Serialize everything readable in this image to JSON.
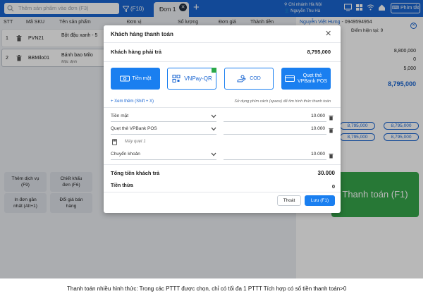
{
  "topbar": {
    "search_placeholder": "Thêm sản phẩm vào đơn (F3)",
    "filter_label": "(F10)",
    "tab_label": "Đơn 1",
    "branch": "Chi nhánh Hà Nội",
    "user": "Nguyễn Thu Hà",
    "keyboard_button": "Phím tắt"
  },
  "table": {
    "headers": [
      "STT",
      "Mã SKU",
      "Tên sản phẩm",
      "Đơn vị",
      "Số lượng",
      "Đơn giá",
      "Thành tiền"
    ],
    "rows": [
      {
        "stt": "1",
        "sku": "PVN21",
        "name": "Bột đậu xanh - 5",
        "note": ""
      },
      {
        "stt": "2",
        "sku": "BBMilo01",
        "name": "Bánh bao Milo",
        "note": "Mặc định"
      }
    ]
  },
  "customer": {
    "name": "Nguyễn Việt Hưng",
    "phone": "- 0949594954",
    "points_label": "Điểm hiện tại:",
    "points_value": "9"
  },
  "summary": {
    "v1": "8,800,000",
    "v2": "0",
    "v3": "5,000",
    "v4": "8,795,000",
    "pill1a": "8,795,000",
    "pill1b": "8,795,000",
    "pill2a": "8,795,000",
    "pill2b": "8,795,000"
  },
  "bottom_buttons": [
    {
      "line1": "Thêm dịch vụ",
      "line2": "(F9)"
    },
    {
      "line1": "Chiết khấu",
      "line2": "đơn (F6)"
    },
    {
      "line1": "In đơn gần",
      "line2": "nhất (Alt+1)"
    },
    {
      "line1": "Đổi giá bán",
      "line2": "hàng"
    }
  ],
  "pay_main_label": "Thanh toán (F1)",
  "dialog": {
    "title": "Khách hàng thanh toán",
    "must_pay_label": "Khách hàng phải trả",
    "must_pay_value": "8,795,000",
    "methods": [
      {
        "label": "Tiền mặt",
        "selected": true,
        "icon": "cash-icon"
      },
      {
        "label": "VNPay-QR",
        "selected": false,
        "icon": "qr-icon"
      },
      {
        "label": "COD",
        "selected": false,
        "icon": "cod-hand-icon"
      },
      {
        "label": "Quẹt thẻ VPBank POS",
        "line1": "Quẹt thẻ",
        "line2": "VPBank POS",
        "selected": true,
        "icon": "card-icon"
      }
    ],
    "see_more": "+ Xem thêm (Shift + X)",
    "hint": "Sử dụng phím cách (space) để tìm hình thức thanh toán",
    "payments": [
      {
        "method": "Tiền mặt",
        "amount": "10.000"
      },
      {
        "method": "Quẹt thẻ VPBank POS",
        "amount": "10.000"
      },
      {
        "method": "Chuyển khoản",
        "amount": "10.000"
      }
    ],
    "machine_placeholder": "Máy quẹt 1",
    "total_label": "Tổng tiền khách trả",
    "total_value": "30.000",
    "change_label": "Tiền thừa",
    "change_value": "0",
    "exit_label": "Thoát",
    "save_label": "Lưu (F1)"
  },
  "caption": "Thanh toán nhiều hình thức: Trong các PTTT được chọn, chỉ có tối đa 1 PTTT Tích hợp có số tiền thanh toán>0",
  "colors": {
    "primary": "#1a66d2",
    "button_blue": "#1a7ff0",
    "pay_green": "#37a74b"
  }
}
